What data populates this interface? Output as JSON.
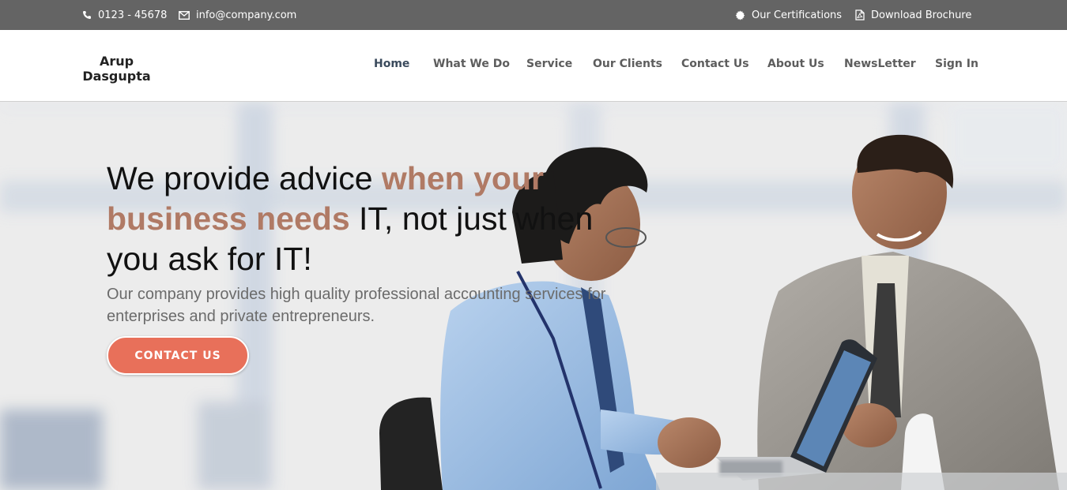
{
  "topbar": {
    "phone": "0123 - 45678",
    "email": "info@company.com",
    "certifications": "Our Certifications",
    "brochure": "Download Brochure"
  },
  "brand": {
    "line1": "Arup",
    "line2": "Dasgupta"
  },
  "nav": {
    "home": "Home",
    "what_we_do": "What We Do",
    "service": "Service",
    "our_clients": "Our Clients",
    "contact_us": "Contact Us",
    "about_us": "About Us",
    "newsletter": "NewsLetter",
    "sign_in": "Sign In",
    "active": "Home"
  },
  "hero": {
    "headline_part1": "We provide advice ",
    "headline_accent": "when your business needs",
    "headline_part2": " IT, not just when you ask for IT!",
    "subtext": "Our company provides high quality professional accounting services for enterprises and private entrepreneurs.",
    "cta_label": "CONTACT US"
  },
  "colors": {
    "topbar_bg": "#646464",
    "accent_text": "#b07a65",
    "cta_bg": "#e8705a",
    "nav_text": "#5d5d5d"
  }
}
